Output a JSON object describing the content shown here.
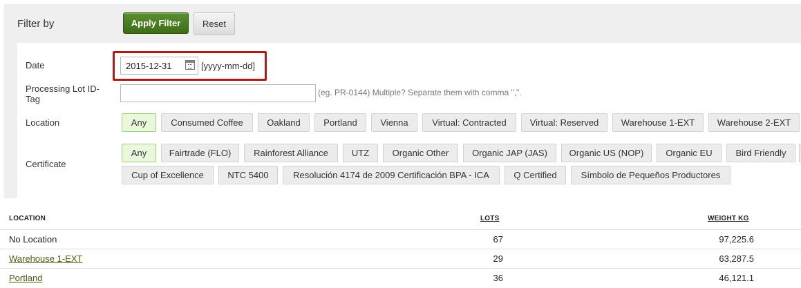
{
  "filter": {
    "title": "Filter by",
    "apply_label": "Apply Filter",
    "reset_label": "Reset",
    "date_label": "Date",
    "date_value": "2015-12-31",
    "date_format": "[yyyy-mm-dd]",
    "lot_label_1": "Processing Lot ID-",
    "lot_label_2": "Tag",
    "lot_value": "",
    "lot_hint": "(eg. PR-0144) Multiple? Separate them with comma \",\".",
    "location_label": "Location",
    "locations": [
      "Any",
      "Consumed Coffee",
      "Oakland",
      "Portland",
      "Vienna",
      "Virtual: Contracted",
      "Virtual: Reserved",
      "Warehouse 1-EXT",
      "Warehouse 2-EXT"
    ],
    "certificate_label": "Certificate",
    "certificates_row1": [
      "Any",
      "Fairtrade (FLO)",
      "Rainforest Alliance",
      "UTZ",
      "Organic Other",
      "Organic JAP (JAS)",
      "Organic US (NOP)",
      "Organic EU",
      "Bird Friendly"
    ],
    "certificates_row2": [
      "Cup of Excellence",
      "NTC 5400",
      "Resolución 4174 de 2009 Certificación BPA - ICA",
      "Q Certified",
      "Símbolo de Pequeños Productores"
    ]
  },
  "table": {
    "headers": {
      "location": "LOCATION",
      "lots": "LOTS",
      "weight": "WEIGHT KG"
    },
    "rows": [
      {
        "location": "No Location",
        "lots": "67",
        "weight": "97,225.6"
      },
      {
        "location": "Warehouse 1-EXT",
        "lots": "29",
        "weight": "63,287.5"
      },
      {
        "location": "Portland",
        "lots": "36",
        "weight": "46,121.1"
      }
    ]
  },
  "colors": {
    "apply_button": "#4a7d22",
    "highlight_border": "#b01a12",
    "active_chip": "#eaf7dc",
    "link": "#4a5c10"
  }
}
